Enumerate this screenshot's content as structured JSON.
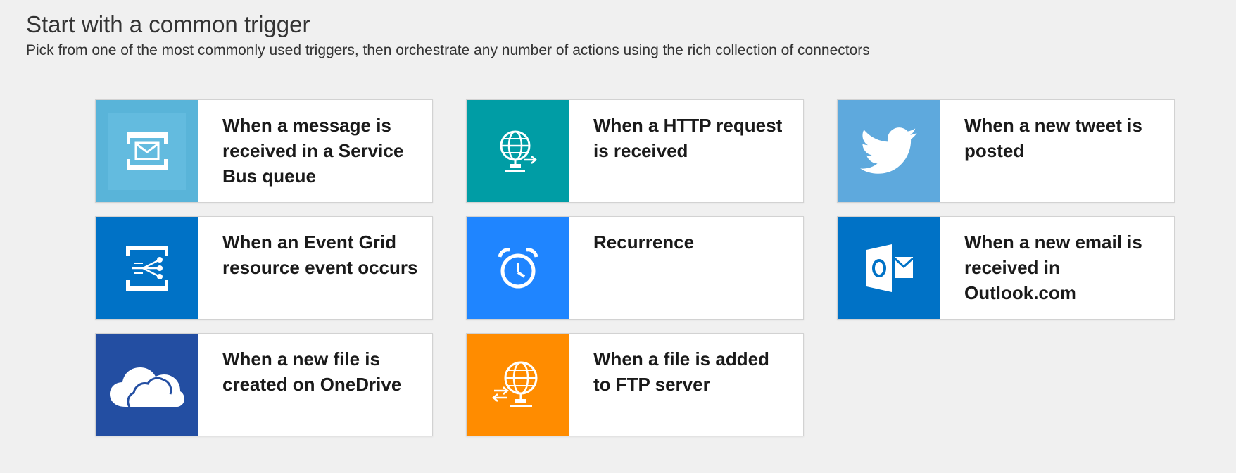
{
  "header": {
    "title": "Start with a common trigger",
    "subtitle": "Pick from one of the most commonly used triggers, then orchestrate any number of actions using the rich collection of connectors"
  },
  "triggers": [
    {
      "label": "When a message is received in a Service Bus queue",
      "icon": "service-bus-icon",
      "color": "#59b4d9"
    },
    {
      "label": "When a HTTP request is received",
      "icon": "http-globe-icon",
      "color": "#009da5"
    },
    {
      "label": "When a new tweet is posted",
      "icon": "twitter-bird-icon",
      "color": "#5ea9dd"
    },
    {
      "label": "When an Event Grid resource event occurs",
      "icon": "event-grid-icon",
      "color": "#0072c6"
    },
    {
      "label": "Recurrence",
      "icon": "alarm-clock-icon",
      "color": "#1f85ff"
    },
    {
      "label": "When a new email is received in Outlook.com",
      "icon": "outlook-icon",
      "color": "#0072c6"
    },
    {
      "label": "When a new file is created on OneDrive",
      "icon": "onedrive-cloud-icon",
      "color": "#234ea2"
    },
    {
      "label": "When a file is added to FTP server",
      "icon": "ftp-globe-icon",
      "color": "#ff8c00"
    }
  ]
}
